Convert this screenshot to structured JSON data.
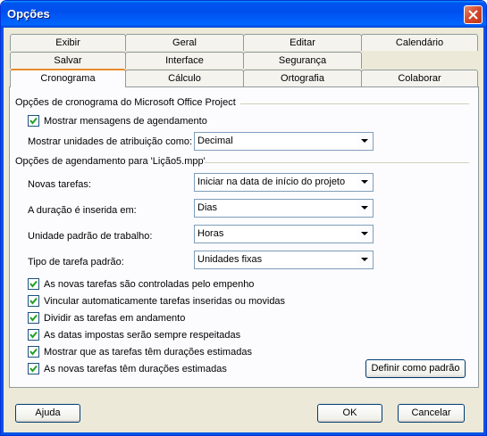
{
  "window": {
    "title": "Opções"
  },
  "tabs": {
    "row1": [
      "Exibir",
      "Geral",
      "Editar",
      "Calendário"
    ],
    "row2": [
      "Salvar",
      "Interface",
      "Segurança"
    ],
    "row3": [
      "Cronograma",
      "Cálculo",
      "Ortografia",
      "Colaborar"
    ],
    "active": "Cronograma"
  },
  "group1": {
    "title": "Opções de cronograma do Microsoft Office Project",
    "show_messages": {
      "label": "Mostrar mensagens de agendamento",
      "checked": true
    },
    "units_label": "Mostrar unidades de atribuição como:",
    "units_value": "Decimal"
  },
  "group2": {
    "title": "Opções de agendamento para 'Lição5.mpp'",
    "fields": [
      {
        "label": "Novas tarefas:",
        "value": "Iniciar na data de início do projeto"
      },
      {
        "label": "A duração é inserida em:",
        "value": "Dias"
      },
      {
        "label": "Unidade padrão de trabalho:",
        "value": "Horas"
      },
      {
        "label": "Tipo de tarefa padrão:",
        "value": "Unidades fixas"
      }
    ],
    "checks": [
      {
        "label": "As novas tarefas são controladas pelo empenho",
        "checked": true
      },
      {
        "label": "Vincular automaticamente tarefas inseridas ou movidas",
        "checked": true
      },
      {
        "label": "Dividir as tarefas em andamento",
        "checked": true
      },
      {
        "label": "As datas impostas serão sempre respeitadas",
        "checked": true
      },
      {
        "label": "Mostrar que as tarefas têm durações estimadas",
        "checked": true
      },
      {
        "label": "As novas tarefas têm durações estimadas",
        "checked": true
      }
    ],
    "default_button": "Definir como padrão"
  },
  "footer": {
    "help": "Ajuda",
    "ok": "OK",
    "cancel": "Cancelar"
  },
  "colors": {
    "titlebar": "#0054e3",
    "dialog_bg": "#ece9d8",
    "active_tab_accent": "#e68b2c"
  }
}
